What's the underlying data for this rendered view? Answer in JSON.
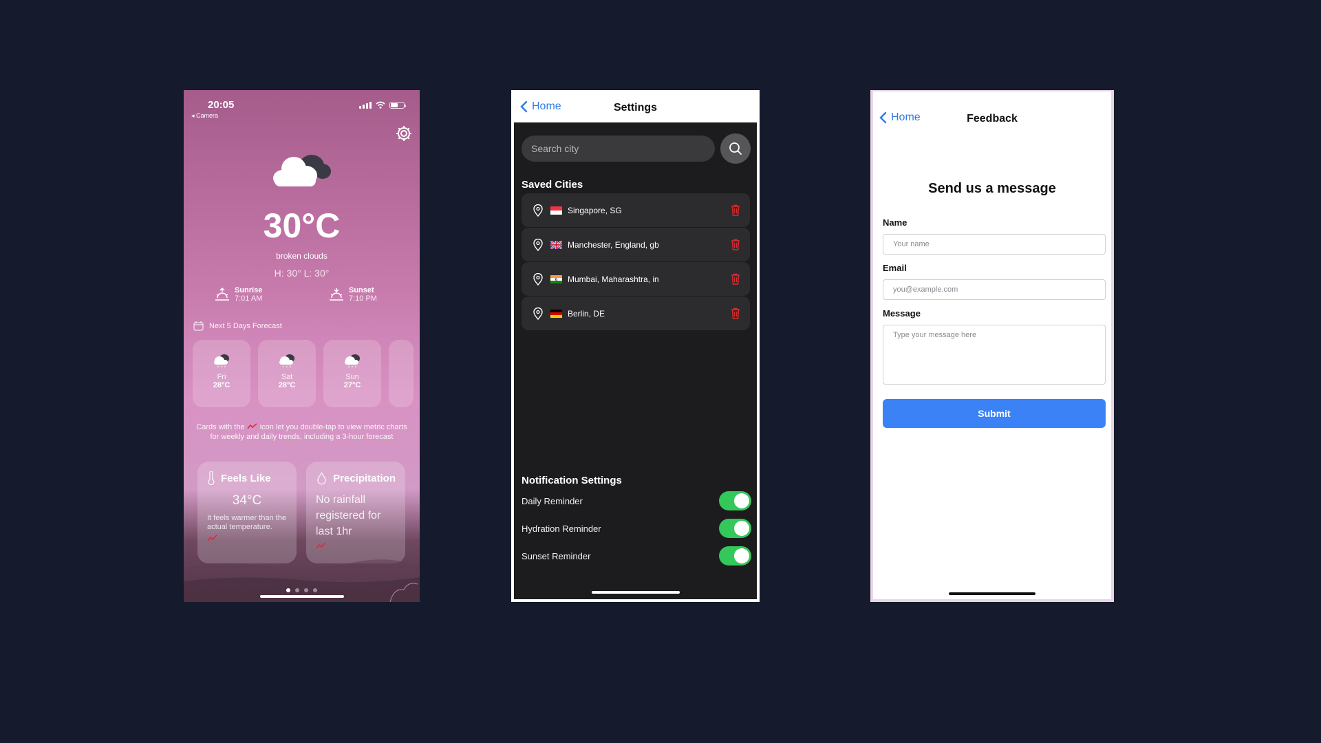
{
  "weather": {
    "status_time": "20:05",
    "back_app": "◂ Camera",
    "temperature": "30°C",
    "description": "broken clouds",
    "high_low": "H: 30° L: 30°",
    "sunrise_label": "Sunrise",
    "sunrise_time": "7:01 AM",
    "sunset_label": "Sunset",
    "sunset_time": "7:10 PM",
    "forecast_title": "Next 5 Days Forecast",
    "forecast": [
      {
        "day": "Fri",
        "temp": "28°C"
      },
      {
        "day": "Sat",
        "temp": "28°C"
      },
      {
        "day": "Sun",
        "temp": "27°C"
      }
    ],
    "hint_before": "Cards with the",
    "hint_after": "icon let you double-tap to view metric charts for weekly and daily trends, including a 3-hour forecast",
    "feels_like": {
      "title": "Feels Like",
      "value": "34°C",
      "note": "It feels warmer than the actual temperature."
    },
    "precipitation": {
      "title": "Precipitation",
      "note": "No rainfall registered for last 1hr"
    },
    "pager_pages": 4,
    "pager_active": 1,
    "battery_level": 0.55
  },
  "settings": {
    "back_label": "Home",
    "title": "Settings",
    "search_placeholder": "Search city",
    "saved_title": "Saved Cities",
    "cities": [
      {
        "name": "Singapore, SG",
        "flag": "sg"
      },
      {
        "name": "Manchester, England, gb",
        "flag": "gb"
      },
      {
        "name": "Mumbai, Maharashtra, in",
        "flag": "in"
      },
      {
        "name": "Berlin, DE",
        "flag": "de"
      }
    ],
    "notif_title": "Notification Settings",
    "toggles": [
      {
        "label": "Daily Reminder",
        "on": true
      },
      {
        "label": "Hydration Reminder",
        "on": true
      },
      {
        "label": "Sunset Reminder",
        "on": true
      }
    ]
  },
  "feedback": {
    "back_label": "Home",
    "title": "Feedback",
    "heading": "Send us a message",
    "name_label": "Name",
    "name_placeholder": "Your name",
    "email_label": "Email",
    "email_placeholder": "you@example.com",
    "message_label": "Message",
    "message_placeholder": "Type your message here",
    "submit_label": "Submit"
  },
  "colors": {
    "accent_blue": "#3b82f6",
    "link_blue": "#2f7be6",
    "toggle_green": "#34c759",
    "delete_red": "#d82b2b"
  }
}
